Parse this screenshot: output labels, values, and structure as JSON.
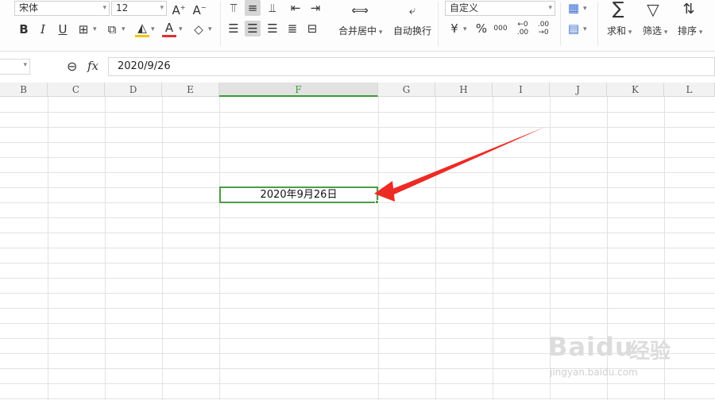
{
  "font_panel": {
    "font_name": "宋体",
    "font_size": "12"
  },
  "alignment_panel": {
    "merge_label": "合并居中",
    "wrap_label": "自动换行"
  },
  "number_panel": {
    "format": "自定义",
    "currency": "¥",
    "percent": "%",
    "thousands": "000"
  },
  "editing_panel": {
    "sum_label": "求和",
    "filter_label": "筛选",
    "sort_label": "排序"
  },
  "formula_bar": {
    "value": "2020/9/26"
  },
  "columns": [
    "B",
    "C",
    "D",
    "E",
    "F",
    "G",
    "H",
    "I",
    "J",
    "K",
    "L"
  ],
  "active_cell": {
    "display": "2020年9月26日"
  },
  "watermark": {
    "brand": "Baidu",
    "brand_cn": "经验",
    "url": "jingyan.baidu.com"
  },
  "colors": {
    "selection": "#4a9d44",
    "arrow": "#ee2a24",
    "font_color_bar": "#e03030",
    "fill_color_bar": "#f5c400"
  },
  "icons": [
    "increase-font-icon",
    "decrease-font-icon",
    "bold-icon",
    "italic-icon",
    "underline-icon",
    "borders-icon",
    "fill-color-icon",
    "font-color-icon",
    "clear-icon",
    "align-top-icon",
    "align-middle-icon",
    "align-bottom-icon",
    "align-left-icon",
    "align-center-icon",
    "align-right-icon",
    "justify-icon",
    "indent-decrease-icon",
    "indent-increase-icon",
    "distributed-icon",
    "merge-center-icon",
    "wrap-text-icon",
    "decimal-increase-icon",
    "decimal-decrease-icon",
    "table-style-icon",
    "conditional-format-icon",
    "sum-icon",
    "filter-icon",
    "sort-icon",
    "zoom-icon",
    "fx-icon"
  ]
}
